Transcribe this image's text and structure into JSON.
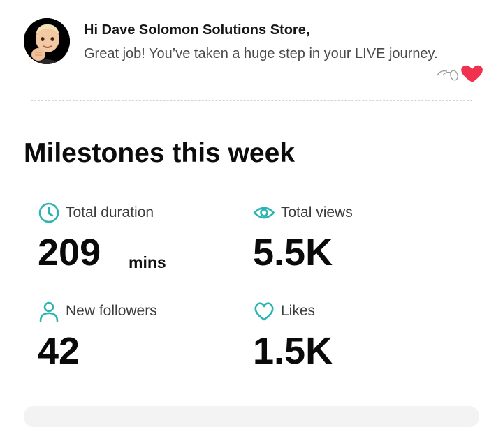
{
  "header": {
    "greeting_name": "Hi Dave Solomon Solutions Store,",
    "greeting_message": "Great job! You’ve taken a huge step in your LIVE journey.",
    "avatar_icon": "memoji-avatar-icon",
    "decoration_icon": "heart-icon"
  },
  "milestones": {
    "title": "Milestones this week",
    "stats": {
      "duration": {
        "icon": "clock-icon",
        "label": "Total duration",
        "value": "209",
        "unit": "mins"
      },
      "views": {
        "icon": "eye-icon",
        "label": "Total views",
        "value": "5.5K"
      },
      "followers": {
        "icon": "person-icon",
        "label": "New followers",
        "value": "42"
      },
      "likes": {
        "icon": "heart-outline-icon",
        "label": "Likes",
        "value": "1.5K"
      }
    }
  },
  "colors": {
    "accent": "#2bb5b0",
    "heart": "#f0324f",
    "text_primary": "#0a0a0a",
    "text_secondary": "#4a4a4a"
  }
}
